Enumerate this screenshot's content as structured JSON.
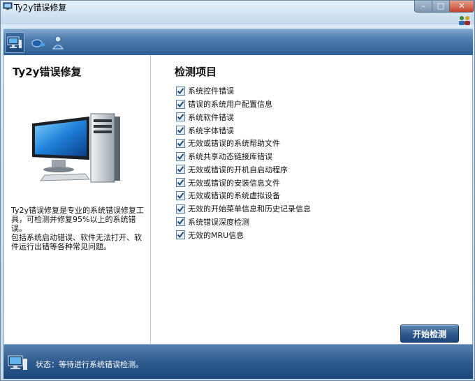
{
  "window": {
    "title": "Ty2y错误修复"
  },
  "toolbar": {
    "items": [
      {
        "icon": "computer-icon"
      },
      {
        "icon": "mouse-icon"
      },
      {
        "icon": "user-icon"
      }
    ]
  },
  "left": {
    "title": "Ty2y错误修复",
    "desc_line1": "Ty2y错误修复是专业的系统错误修复工具，可检测并修复95%以上的系统错误。",
    "desc_line2": "包括系统启动错误、软件无法打开、软件运行出错等各种常见问题。"
  },
  "right": {
    "title": "检测项目",
    "items": [
      {
        "label": "系统控件错误",
        "checked": true
      },
      {
        "label": "错误的系统用户配置信息",
        "checked": true
      },
      {
        "label": "系统软件错误",
        "checked": true
      },
      {
        "label": "系统字体错误",
        "checked": true
      },
      {
        "label": "无效或错误的系统帮助文件",
        "checked": true
      },
      {
        "label": "系统共享动态链接库错误",
        "checked": true
      },
      {
        "label": "无效或错误的开机自启动程序",
        "checked": true
      },
      {
        "label": "无效或错误的安装信息文件",
        "checked": true
      },
      {
        "label": "无效或错误的系统虚拟设备",
        "checked": true
      },
      {
        "label": "无效的开始菜单信息和历史记录信息",
        "checked": true
      },
      {
        "label": "系统错误深度检测",
        "checked": true
      },
      {
        "label": "无效的MRU信息",
        "checked": true
      }
    ],
    "start_button": "开始检测"
  },
  "status": {
    "text": "状态：等待进行系统错误检测。"
  },
  "colors": {
    "accent": "#2f5b8e",
    "check": "#1f4a7c"
  }
}
